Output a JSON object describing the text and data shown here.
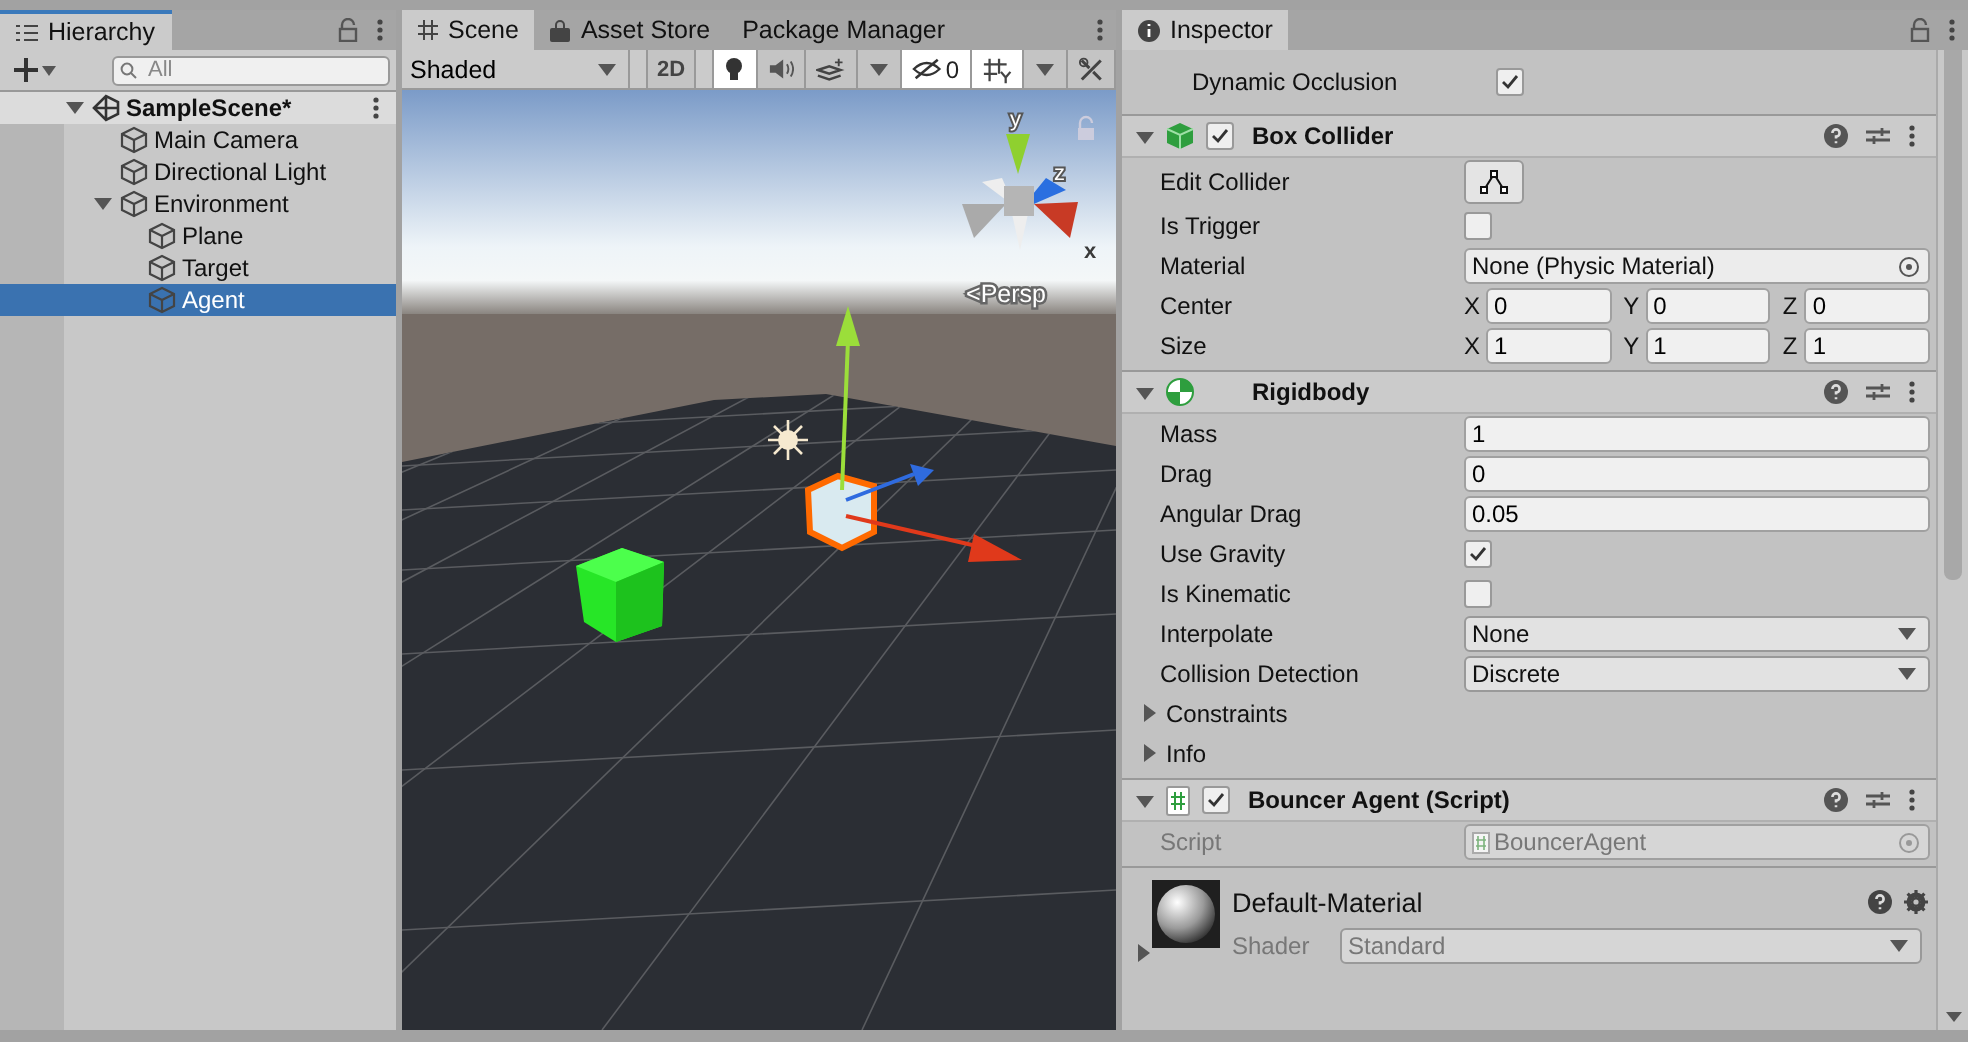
{
  "hierarchy": {
    "tab": {
      "label": "Hierarchy",
      "focused": true
    },
    "search": {
      "placeholder": "All"
    },
    "tree": [
      {
        "label": "SampleScene*",
        "kind": "scene",
        "expanded": true,
        "selected": false,
        "children": [
          {
            "label": "Main Camera",
            "kind": "object",
            "selected": false
          },
          {
            "label": "Directional Light",
            "kind": "object",
            "selected": false
          },
          {
            "label": "Environment",
            "kind": "object",
            "expanded": true,
            "selected": false,
            "children": [
              {
                "label": "Plane",
                "kind": "object",
                "selected": false
              },
              {
                "label": "Target",
                "kind": "object",
                "selected": false
              },
              {
                "label": "Agent",
                "kind": "object",
                "selected": true
              }
            ]
          }
        ]
      }
    ]
  },
  "scene": {
    "tabs": [
      {
        "label": "Scene",
        "kind": "scene",
        "selected": true
      },
      {
        "label": "Asset Store",
        "kind": "store",
        "selected": false
      },
      {
        "label": "Package Manager",
        "kind": "plain",
        "selected": false
      }
    ],
    "toolbar": {
      "shading": "Shaded",
      "mode_2d": {
        "label": "2D",
        "on": false
      },
      "toggles": [
        {
          "kind": "lighting",
          "on": true
        },
        {
          "kind": "audio",
          "on": false
        },
        {
          "kind": "effects",
          "on": false
        },
        {
          "kind": "visibility",
          "on": true,
          "count": "0"
        },
        {
          "kind": "grid",
          "on": true
        },
        {
          "kind": "tools",
          "on": false
        }
      ]
    },
    "gizmo": {
      "axis_y": "y",
      "axis_z": "z",
      "axis_x": "x",
      "projection": "Persp",
      "projection_marker": "<"
    }
  },
  "inspector": {
    "tab": "Inspector",
    "top_rows": [
      {
        "label": "Dynamic Occlusion",
        "kind": "checkbox",
        "checked": true
      }
    ],
    "components": [
      {
        "name": "Box Collider",
        "kind": "box_collider",
        "enabled": true,
        "expanded": true,
        "fields": [
          {
            "label": "Edit Collider",
            "kind": "edit_button"
          },
          {
            "label": "Is Trigger",
            "kind": "checkbox",
            "checked": false
          },
          {
            "label": "Material",
            "kind": "object",
            "value": "None (Physic Material)"
          },
          {
            "label": "Center",
            "kind": "vector3",
            "axes": [
              {
                "axis": "X",
                "value": "0"
              },
              {
                "axis": "Y",
                "value": "0"
              },
              {
                "axis": "Z",
                "value": "0"
              }
            ]
          },
          {
            "label": "Size",
            "kind": "vector3",
            "axes": [
              {
                "axis": "X",
                "value": "1"
              },
              {
                "axis": "Y",
                "value": "1"
              },
              {
                "axis": "Z",
                "value": "1"
              }
            ]
          }
        ]
      },
      {
        "name": "Rigidbody",
        "kind": "rigidbody",
        "expanded": true,
        "fields": [
          {
            "label": "Mass",
            "kind": "text",
            "value": "1"
          },
          {
            "label": "Drag",
            "kind": "text",
            "value": "0"
          },
          {
            "label": "Angular Drag",
            "kind": "text",
            "value": "0.05"
          },
          {
            "label": "Use Gravity",
            "kind": "checkbox",
            "checked": true
          },
          {
            "label": "Is Kinematic",
            "kind": "checkbox",
            "checked": false
          },
          {
            "label": "Interpolate",
            "kind": "dropdown",
            "value": "None"
          },
          {
            "label": "Collision Detection",
            "kind": "dropdown",
            "value": "Discrete"
          },
          {
            "label": "Constraints",
            "kind": "foldout",
            "expanded": false
          },
          {
            "label": "Info",
            "kind": "foldout",
            "expanded": false
          }
        ]
      },
      {
        "name": "Bouncer Agent (Script)",
        "kind": "script",
        "enabled": true,
        "expanded": true,
        "fields": [
          {
            "label": "Script",
            "kind": "script",
            "value": "BouncerAgent",
            "disabled": true
          }
        ]
      }
    ],
    "material": {
      "name": "Default-Material",
      "shader_label": "Shader",
      "shader": "Standard",
      "expanded": false
    }
  }
}
